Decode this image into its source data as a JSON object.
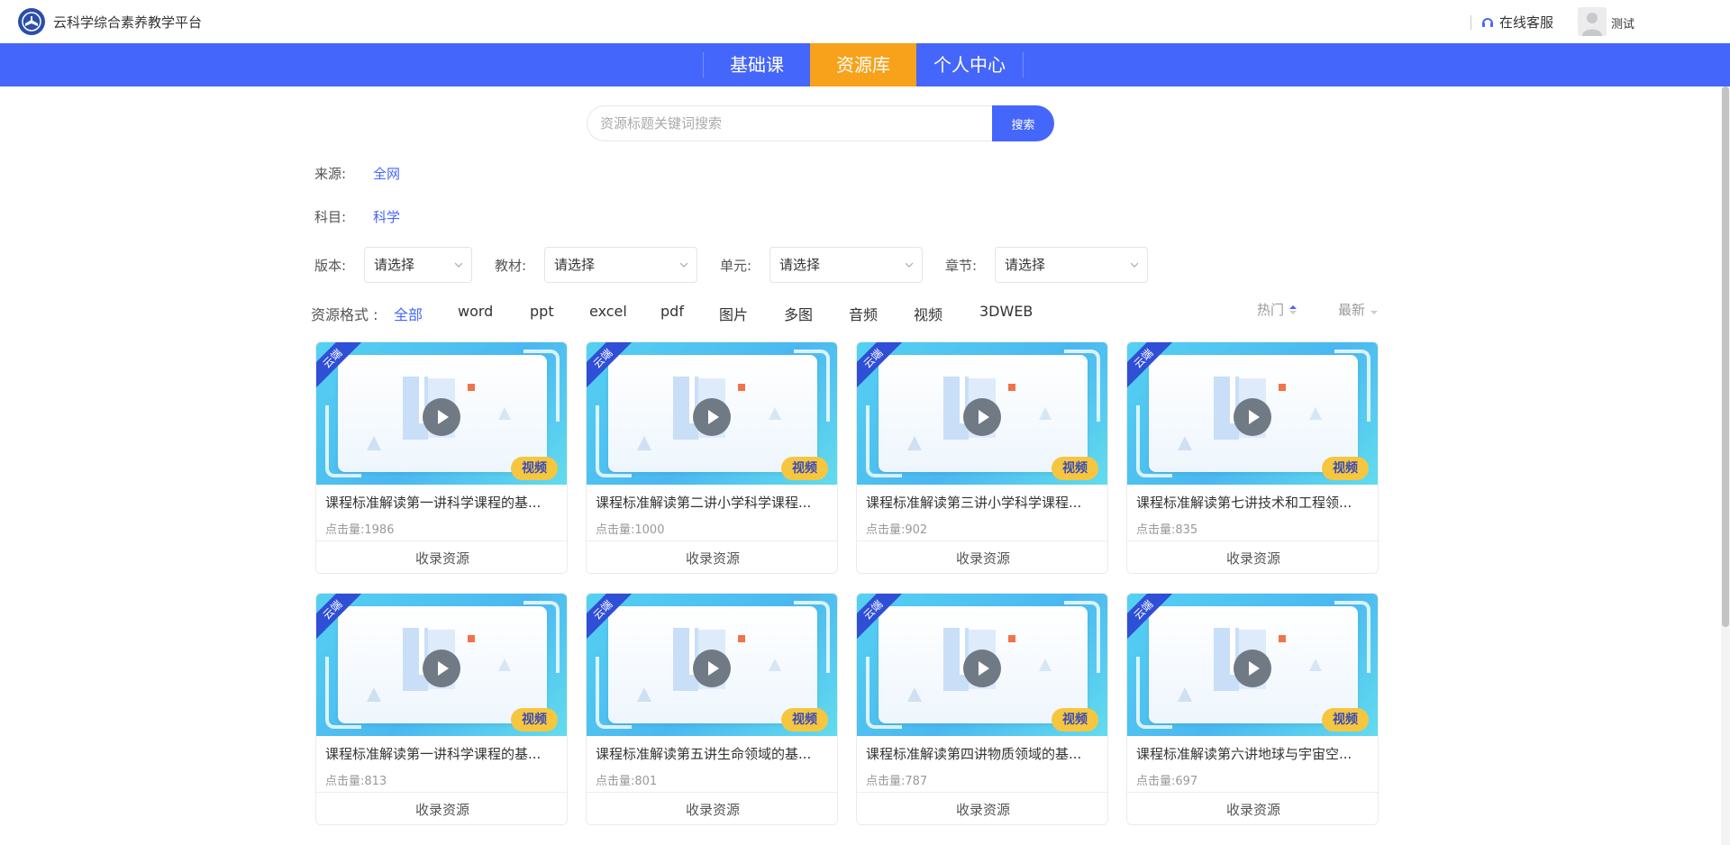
{
  "header": {
    "site_title": "云科学综合素养教学平台",
    "support_label": "在线客服",
    "username": "测试"
  },
  "nav": {
    "items": [
      {
        "label": "基础课"
      },
      {
        "label": "资源库"
      },
      {
        "label": "个人中心"
      }
    ],
    "active_index": 1
  },
  "search": {
    "value": "",
    "placeholder": "资源标题关键词搜索",
    "button_label": "搜索"
  },
  "filters": {
    "source_label": "来源:",
    "source_value": "全网",
    "subject_label": "科目:",
    "subject_value": "科学",
    "edition_label": "版本:",
    "edition_value": "请选择",
    "textbook_label": "教材:",
    "textbook_value": "请选择",
    "unit_label": "单元:",
    "unit_value": "请选择",
    "chapter_label": "章节:",
    "chapter_value": "请选择"
  },
  "formats": {
    "label": "资源格式 :",
    "items": [
      "全部",
      "word",
      "ppt",
      "excel",
      "pdf",
      "图片",
      "多图",
      "音频",
      "视频",
      "3DWEB"
    ],
    "active_index": 0
  },
  "sort": {
    "hot_label": "热门",
    "new_label": "最新"
  },
  "cards": [
    {
      "ribbon": "云端",
      "badge": "视频",
      "title": "课程标准解读第一讲科学课程的基...",
      "views_label": "点击量:",
      "views": "1986",
      "collect_label": "收录资源"
    },
    {
      "ribbon": "云端",
      "badge": "视频",
      "title": "课程标准解读第二讲小学科学课程...",
      "views_label": "点击量:",
      "views": "1000",
      "collect_label": "收录资源"
    },
    {
      "ribbon": "云端",
      "badge": "视频",
      "title": "课程标准解读第三讲小学科学课程...",
      "views_label": "点击量:",
      "views": "902",
      "collect_label": "收录资源"
    },
    {
      "ribbon": "云端",
      "badge": "视频",
      "title": "课程标准解读第七讲技术和工程领...",
      "views_label": "点击量:",
      "views": "835",
      "collect_label": "收录资源"
    },
    {
      "ribbon": "云端",
      "badge": "视频",
      "title": "课程标准解读第一讲科学课程的基...",
      "views_label": "点击量:",
      "views": "813",
      "collect_label": "收录资源"
    },
    {
      "ribbon": "云端",
      "badge": "视频",
      "title": "课程标准解读第五讲生命领域的基...",
      "views_label": "点击量:",
      "views": "801",
      "collect_label": "收录资源"
    },
    {
      "ribbon": "云端",
      "badge": "视频",
      "title": "课程标准解读第四讲物质领域的基...",
      "views_label": "点击量:",
      "views": "787",
      "collect_label": "收录资源"
    },
    {
      "ribbon": "云端",
      "badge": "视频",
      "title": "课程标准解读第六讲地球与宇宙空...",
      "views_label": "点击量:",
      "views": "697",
      "collect_label": "收录资源"
    }
  ],
  "colors": {
    "primary": "#4566fb",
    "nav_active": "#f7a21a",
    "badge": "#f6c63f"
  }
}
